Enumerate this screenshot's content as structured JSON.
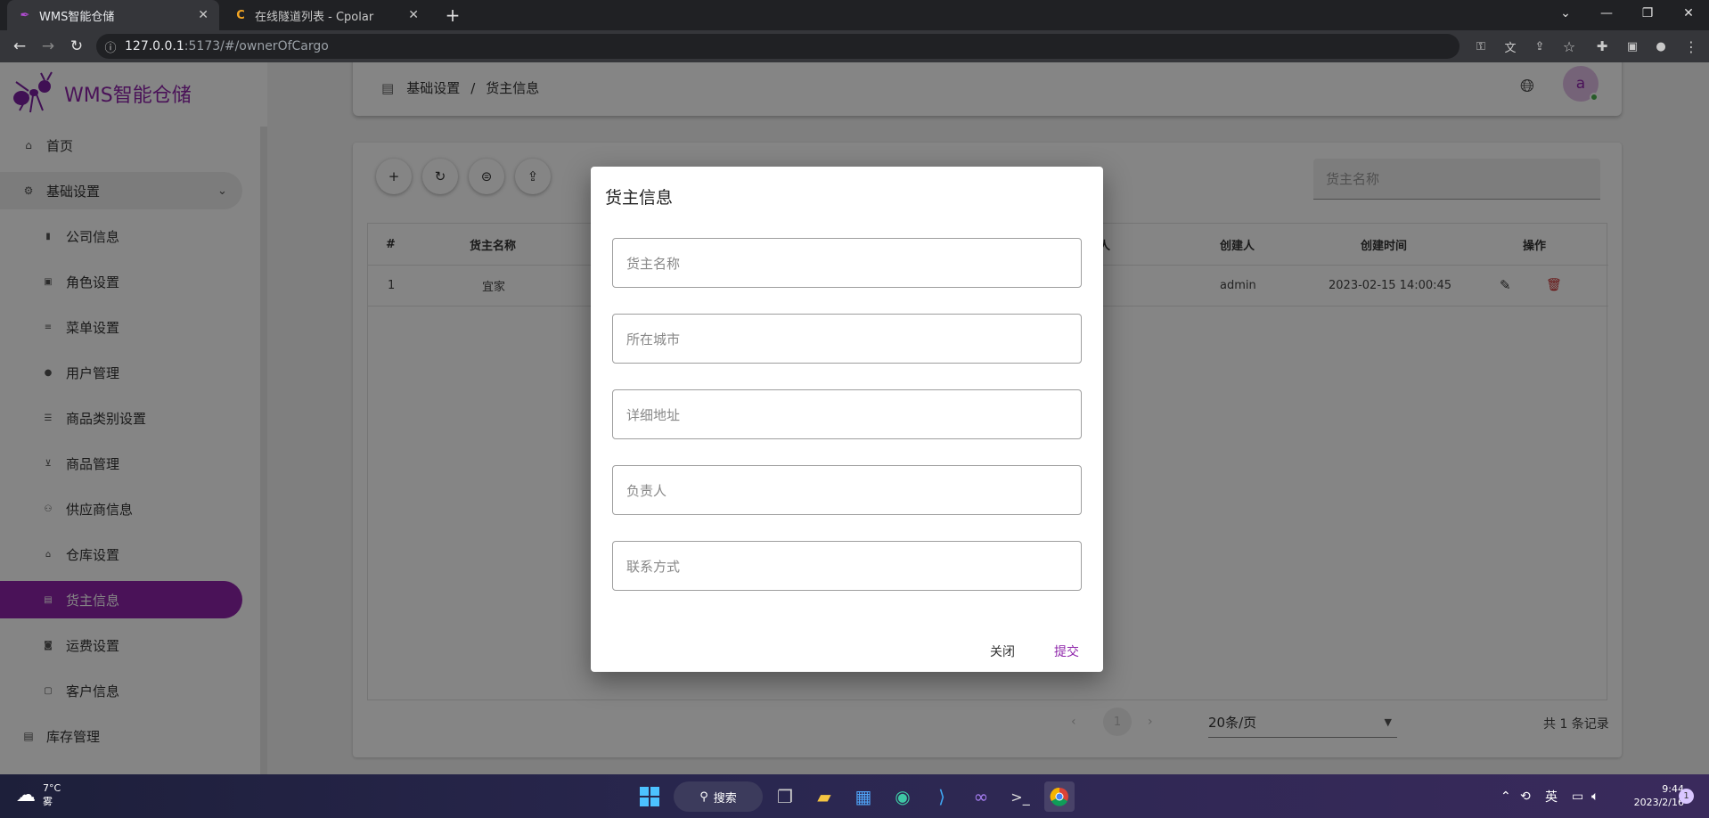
{
  "browser": {
    "tabs": [
      {
        "title": "WMS智能仓储",
        "active": true
      },
      {
        "title": "在线隧道列表 - Cpolar",
        "active": false
      }
    ],
    "url_host": "127.0.0.1",
    "url_rest": ":5173/#/ownerOfCargo"
  },
  "app": {
    "logo_text": "WMS智能仓储",
    "breadcrumb": {
      "parent": "基础设置",
      "separator": "/",
      "current": "货主信息"
    },
    "user_avatar": "a",
    "accent_color": "#8e24aa"
  },
  "sidebar": {
    "home": "首页",
    "group": "基础设置",
    "items": [
      {
        "label": "公司信息",
        "icon": "company-icon"
      },
      {
        "label": "角色设置",
        "icon": "role-icon"
      },
      {
        "label": "菜单设置",
        "icon": "menu-icon"
      },
      {
        "label": "用户管理",
        "icon": "user-icon"
      },
      {
        "label": "商品类别设置",
        "icon": "list-icon"
      },
      {
        "label": "商品管理",
        "icon": "cart-icon"
      },
      {
        "label": "供应商信息",
        "icon": "supplier-icon"
      },
      {
        "label": "仓库设置",
        "icon": "warehouse-icon"
      },
      {
        "label": "货主信息",
        "icon": "owner-icon"
      },
      {
        "label": "运费设置",
        "icon": "freight-icon"
      },
      {
        "label": "客户信息",
        "icon": "customer-icon"
      }
    ],
    "inventory": "库存管理"
  },
  "search": {
    "placeholder": "货主名称"
  },
  "table": {
    "columns": {
      "index": "#",
      "name": "货主名称",
      "contact_partial": "人",
      "creator": "创建人",
      "created": "创建时间",
      "ops": "操作"
    },
    "rows": [
      {
        "index": "1",
        "name": "宜家",
        "creator": "admin",
        "created": "2023-02-15 14:00:45"
      }
    ]
  },
  "pager": {
    "page": "1",
    "page_size": "20条/页",
    "total": "共 1 条记录"
  },
  "dialog": {
    "title": "货主信息",
    "fields": {
      "name": "货主名称",
      "city": "所在城市",
      "address": "详细地址",
      "manager": "负责人",
      "contact": "联系方式"
    },
    "close_label": "关闭",
    "submit_label": "提交"
  },
  "taskbar": {
    "weather_temp": "7°C",
    "weather_desc": "雾",
    "search_label": "搜索",
    "ime": "英",
    "time": "9:44",
    "date": "2023/2/16",
    "notification_count": "1"
  }
}
